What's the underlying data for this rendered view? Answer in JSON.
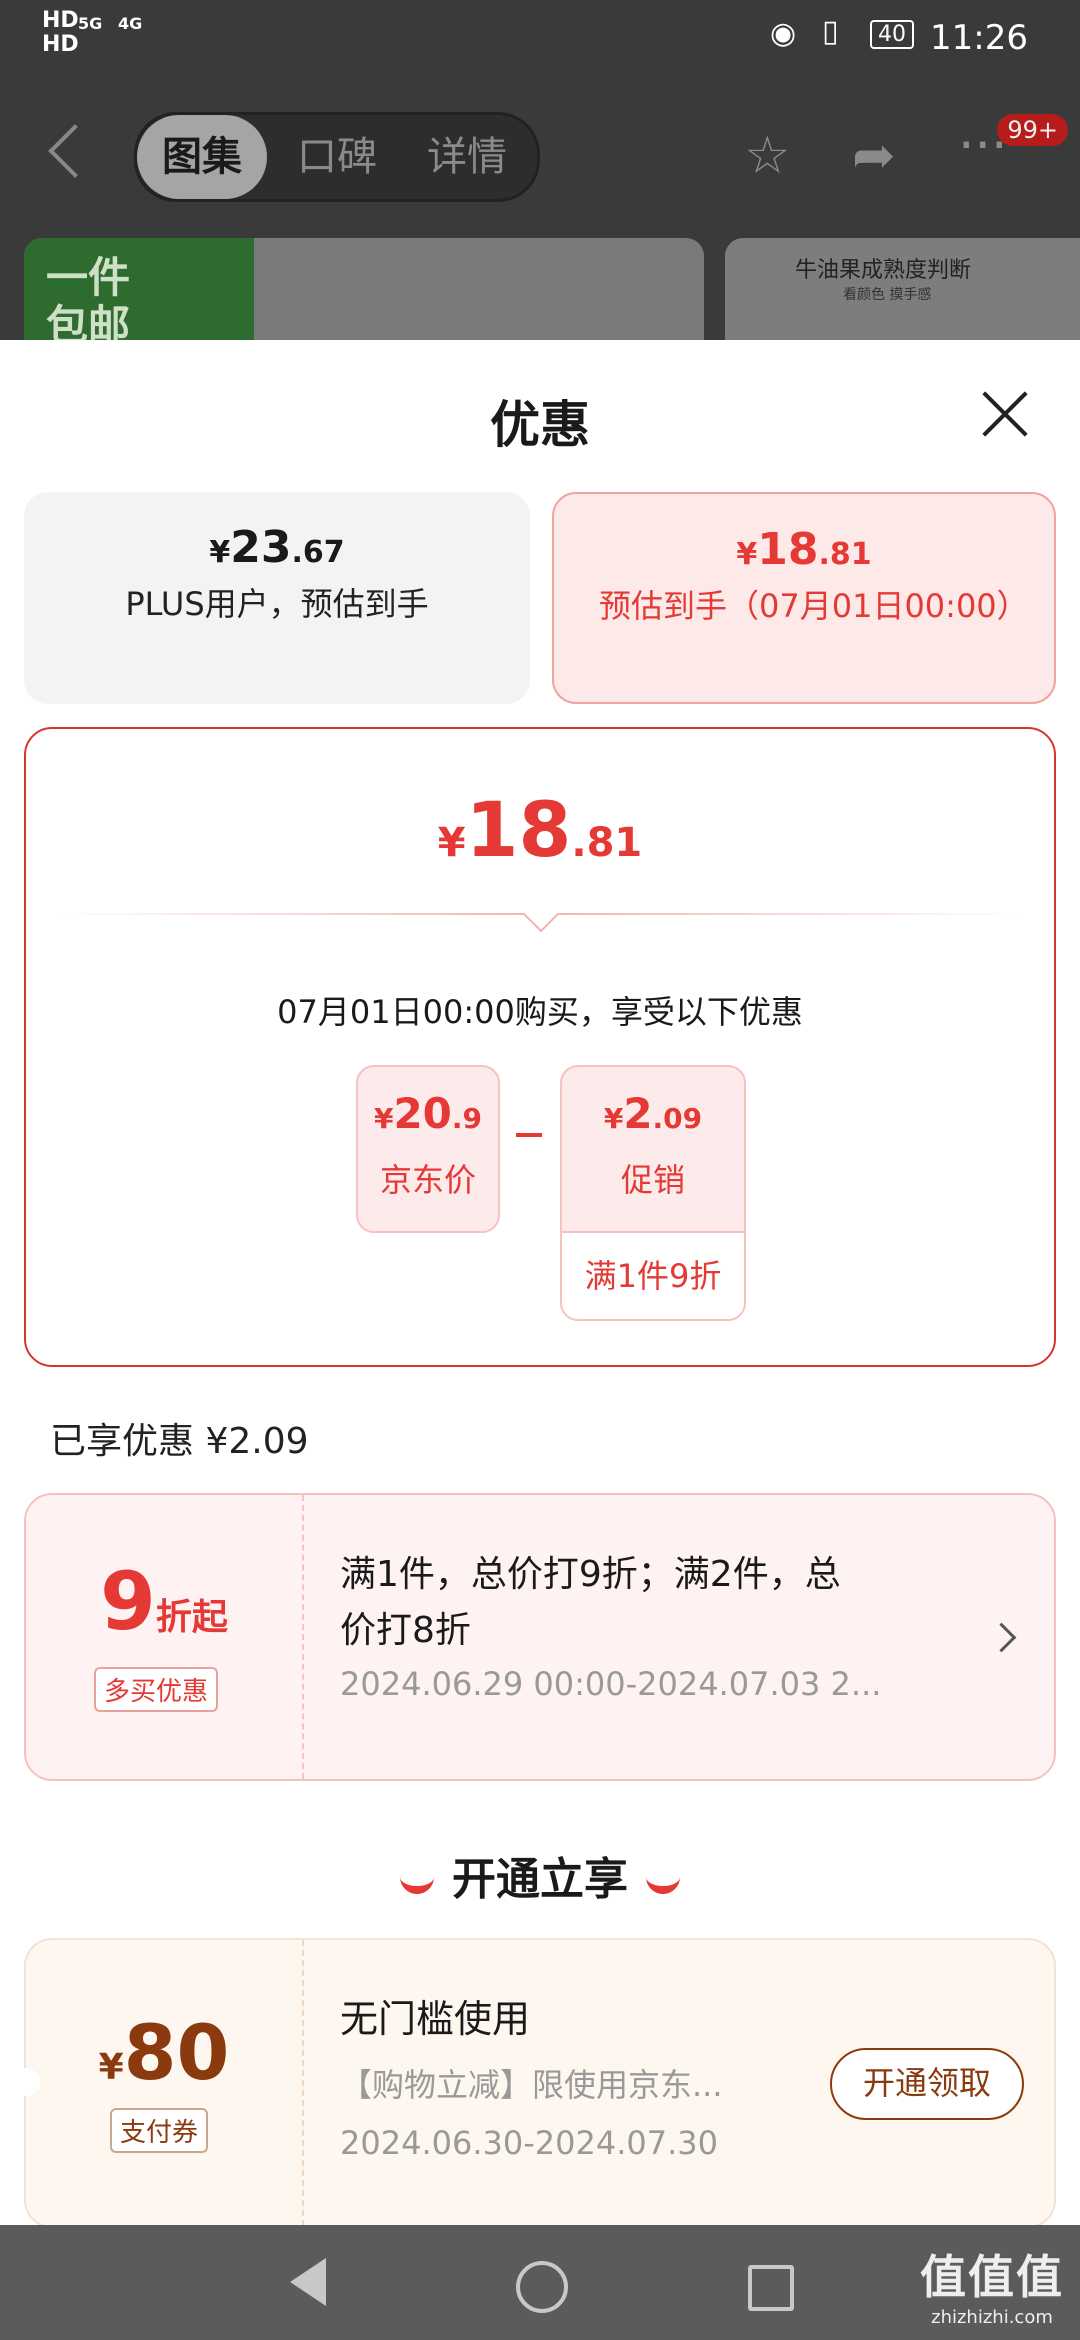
{
  "status_bar": {
    "network_1": "HD",
    "network_2": "5G",
    "network_3": "4G",
    "battery": "40",
    "time": "11:26"
  },
  "nav": {
    "tabs": [
      {
        "label": "图集",
        "active": true
      },
      {
        "label": "口碑",
        "active": false
      },
      {
        "label": "详情",
        "active": false
      }
    ],
    "badge": "99+"
  },
  "background": {
    "thumb1_text": "一件包邮",
    "thumb2_title": "牛油果成熟度判断",
    "thumb2_sub": "看颜色  摸手感"
  },
  "sheet": {
    "title": "优惠",
    "options": [
      {
        "currency": "¥",
        "int": "23",
        "dec": ".67",
        "desc": "PLUS用户，预估到手"
      },
      {
        "currency": "¥",
        "int": "18",
        "dec": ".81",
        "desc": "预估到手（07月01日00:00）"
      }
    ],
    "detail": {
      "currency": "¥",
      "int": "18",
      "dec": ".81",
      "buy_line": "07月01日00:00购买，享受以下优惠",
      "jd_price": {
        "currency": "¥",
        "int": "20",
        "dec": ".9",
        "label": "京东价"
      },
      "promo_price": {
        "currency": "¥",
        "int": "2",
        "dec": ".09",
        "label": "促销",
        "footer": "满1件9折"
      }
    },
    "enjoyed": "已享优惠 ¥2.09",
    "promo_card": {
      "num": "9",
      "unit": "折起",
      "tag": "多买优惠",
      "text": "满1件，总价打9折；满2件，总价打8折",
      "date": "2024.06.29 00:00-2024.07.03 2..."
    },
    "section_title": "开通立享",
    "coupon": {
      "currency": "¥",
      "amount": "80",
      "tag": "支付券",
      "title": "无门槛使用",
      "sub": "【购物立减】限使用京东...",
      "date": "2024.06.30-2024.07.30",
      "button": "开通领取"
    }
  },
  "watermark": {
    "main": "值值值",
    "sub": "zhizhizhi.com"
  },
  "colors": {
    "accent": "#e53935",
    "coupon_brown": "#8b3a10"
  }
}
